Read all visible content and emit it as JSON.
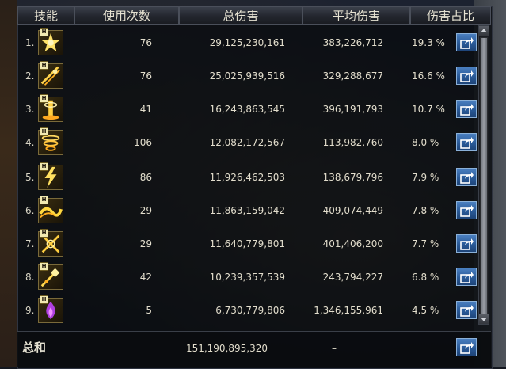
{
  "header": {
    "skill": "技能",
    "uses": "使用次数",
    "total": "总伤害",
    "avg": "平均伤害",
    "pct": "伤害占比"
  },
  "badge_letter": "H",
  "rows": [
    {
      "rank": "1.",
      "icon": "star-burst-skill-icon",
      "uses": "76",
      "total": "29,125,230,161",
      "avg": "383,226,712",
      "pct": "19.3 %"
    },
    {
      "rank": "2.",
      "icon": "double-slash-skill-icon",
      "uses": "76",
      "total": "25,025,939,516",
      "avg": "329,288,677",
      "pct": "16.6 %"
    },
    {
      "rank": "3.",
      "icon": "fire-pillar-skill-icon",
      "uses": "41",
      "total": "16,243,863,545",
      "avg": "396,191,793",
      "pct": "10.7 %"
    },
    {
      "rank": "4.",
      "icon": "whirlwind-skill-icon",
      "uses": "106",
      "total": "12,082,172,567",
      "avg": "113,982,760",
      "pct": "8.0 %"
    },
    {
      "rank": "5.",
      "icon": "lightning-skill-icon",
      "uses": "86",
      "total": "11,926,462,503",
      "avg": "138,679,796",
      "pct": "7.9 %"
    },
    {
      "rank": "6.",
      "icon": "golden-wave-skill-icon",
      "uses": "29",
      "total": "11,863,159,042",
      "avg": "409,074,449",
      "pct": "7.8 %"
    },
    {
      "rank": "7.",
      "icon": "cross-slash-skill-icon",
      "uses": "29",
      "total": "11,640,779,801",
      "avg": "401,406,200",
      "pct": "7.7 %"
    },
    {
      "rank": "8.",
      "icon": "spark-thrust-skill-icon",
      "uses": "42",
      "total": "10,239,357,539",
      "avg": "243,794,227",
      "pct": "6.8 %"
    },
    {
      "rank": "9.",
      "icon": "purple-flame-skill-icon",
      "uses": "5",
      "total": "6,730,779,806",
      "avg": "1,346,155,961",
      "pct": "4.5 %"
    }
  ],
  "footer": {
    "label": "总和",
    "total": "151,190,895,320",
    "avg": "–"
  },
  "colors": {
    "text": "#e2ddcc",
    "share_button": "#2a5a98"
  }
}
